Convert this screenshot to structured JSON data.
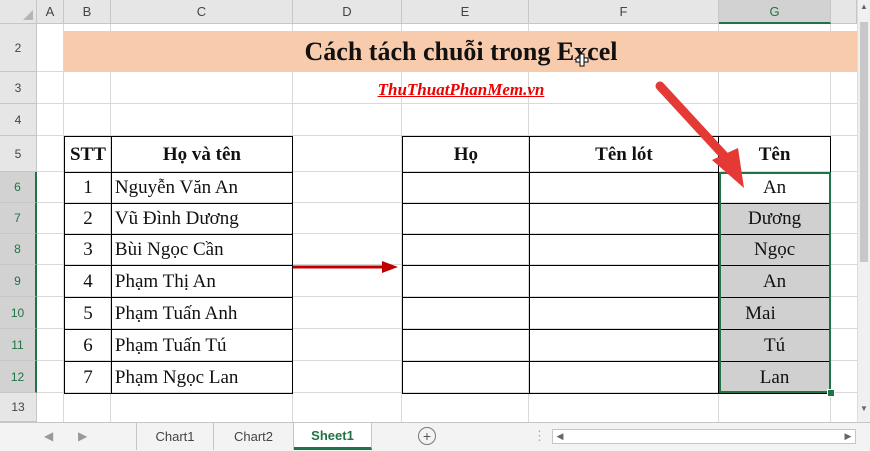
{
  "columns": [
    "A",
    "B",
    "C",
    "D",
    "E",
    "F",
    "G"
  ],
  "rows": [
    "2",
    "3",
    "4",
    "5",
    "6",
    "7",
    "8",
    "9",
    "10",
    "11",
    "12",
    "13"
  ],
  "title": "Cách tách chuỗi trong Excel",
  "subtitle": "ThuThuatPhanMem.vn",
  "left_table": {
    "headers": [
      "STT",
      "Họ và tên"
    ],
    "rows": [
      {
        "stt": "1",
        "name": "Nguyễn Văn An"
      },
      {
        "stt": "2",
        "name": "Vũ Đình Dương"
      },
      {
        "stt": "3",
        "name": "Bùi Ngọc Cần"
      },
      {
        "stt": "4",
        "name": "Phạm Thị An"
      },
      {
        "stt": "5",
        "name": "Phạm Tuấn Anh"
      },
      {
        "stt": "6",
        "name": "Phạm Tuấn Tú"
      },
      {
        "stt": "7",
        "name": "Phạm Ngọc Lan"
      }
    ]
  },
  "right_table": {
    "headers": [
      "Họ",
      "Tên lót",
      "Tên"
    ],
    "ten": [
      "An",
      "Dương",
      "Ngọc",
      "An",
      "Mai",
      "Tú",
      "Lan"
    ]
  },
  "sheet_tabs": [
    "Chart1",
    "Chart2",
    "Sheet1"
  ],
  "active_tab": "Sheet1",
  "colors": {
    "accent": "#217346",
    "title_fill": "#f8cbad",
    "arrow": "#c00000",
    "link": "#ff0000",
    "selection_fill": "#d0d0d0"
  }
}
